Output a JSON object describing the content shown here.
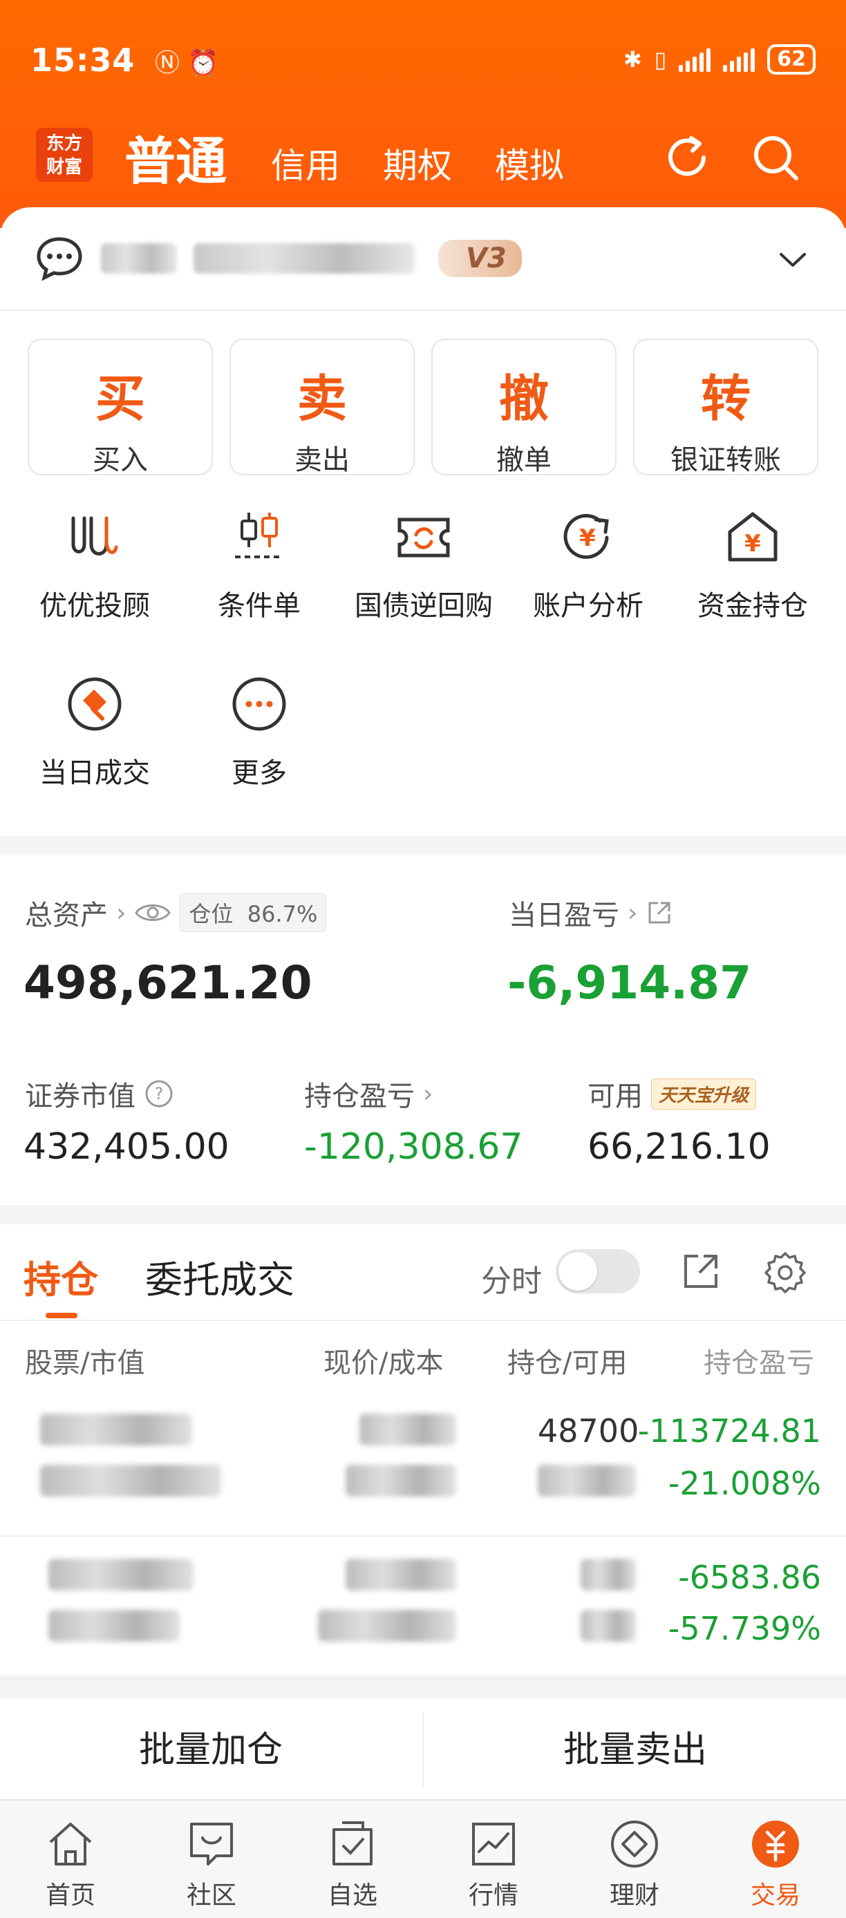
{
  "status_bar": {
    "time": "15:34",
    "battery": "62"
  },
  "header": {
    "logo_line1": "东方",
    "logo_line2": "财富",
    "tabs": [
      {
        "label": "普通",
        "active": true
      },
      {
        "label": "信用",
        "active": false
      },
      {
        "label": "期权",
        "active": false
      },
      {
        "label": "模拟",
        "active": false
      }
    ]
  },
  "account": {
    "vip_level": "V3"
  },
  "quick_actions": [
    {
      "char": "买",
      "label": "买入"
    },
    {
      "char": "卖",
      "label": "卖出"
    },
    {
      "char": "撤",
      "label": "撤单"
    },
    {
      "char": "转",
      "label": "银证转账"
    }
  ],
  "tools": [
    {
      "label": "优优投顾",
      "icon": "youyou-advisor-icon"
    },
    {
      "label": "条件单",
      "icon": "conditional-order-icon"
    },
    {
      "label": "国债逆回购",
      "icon": "reverse-repo-icon"
    },
    {
      "label": "账户分析",
      "icon": "account-analysis-icon"
    },
    {
      "label": "资金持仓",
      "icon": "funds-holdings-icon"
    },
    {
      "label": "当日成交",
      "icon": "today-deals-icon"
    },
    {
      "label": "更多",
      "icon": "more-icon"
    }
  ],
  "assets": {
    "total_label": "总资产",
    "position_label": "仓位",
    "position_value": "86.7%",
    "total_value": "498,621.20",
    "daily_pnl_label": "当日盈亏",
    "daily_pnl_value": "-6,914.87",
    "market_value_label": "证券市值",
    "market_value": "432,405.00",
    "holding_pnl_label": "持仓盈亏",
    "holding_pnl_value": "-120,308.67",
    "available_label": "可用",
    "available_badge": "天天宝升级",
    "available_value": "66,216.10"
  },
  "holdings": {
    "tab_active": "持仓",
    "tab_other": "委托成交",
    "fenshi_label": "分时",
    "columns": [
      "股票/市值",
      "现价/成本",
      "持仓/可用",
      "持仓盈亏"
    ],
    "rows": [
      {
        "qty": "48700",
        "pnl": "-113724.81",
        "pnl_pct": "-21.008%"
      },
      {
        "qty": "",
        "pnl": "-6583.86",
        "pnl_pct": "-57.739%"
      }
    ]
  },
  "batch": {
    "add": "批量加仓",
    "sell": "批量卖出"
  },
  "bottom_nav": [
    {
      "label": "首页",
      "icon": "home-icon",
      "active": false
    },
    {
      "label": "社区",
      "icon": "community-icon",
      "active": false
    },
    {
      "label": "自选",
      "icon": "watchlist-icon",
      "active": false
    },
    {
      "label": "行情",
      "icon": "market-icon",
      "active": false
    },
    {
      "label": "理财",
      "icon": "wealth-icon",
      "active": false
    },
    {
      "label": "交易",
      "icon": "trade-icon",
      "active": true
    }
  ],
  "colors": {
    "brand": "#ff6a00",
    "accent": "#f05a14",
    "loss_green": "#1aa035"
  }
}
